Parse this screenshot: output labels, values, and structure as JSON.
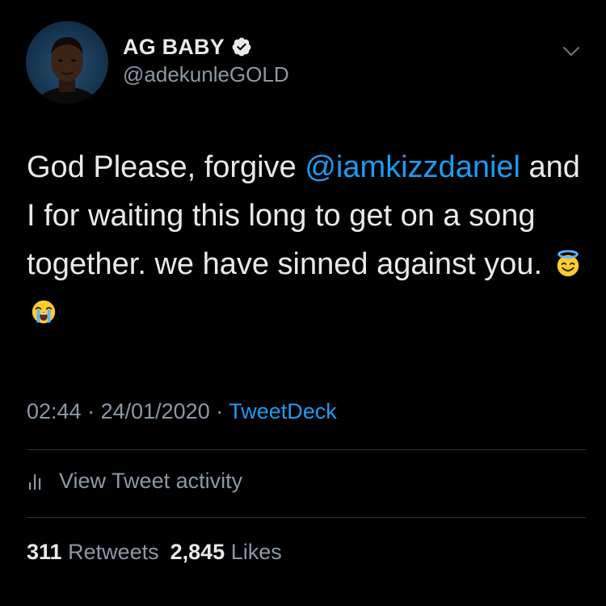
{
  "user": {
    "display_name": "AG BABY",
    "handle": "@adekunleGOLD",
    "verified": true
  },
  "tweet": {
    "text_before": "God Please, forgive ",
    "mention": "@iamkizzdaniel",
    "text_after": " and I for waiting this long to get on a song together. we have sinned against you.",
    "emojis": [
      "smiling-face-with-halo",
      "loudly-crying-face"
    ]
  },
  "meta": {
    "time": "02:44",
    "separator": " · ",
    "date": "24/01/2020",
    "source": "TweetDeck"
  },
  "activity": {
    "label": "View Tweet activity"
  },
  "stats": {
    "retweets_count": "311",
    "retweets_label": " Retweets",
    "likes_count": "2,845",
    "likes_label": " Likes"
  },
  "colors": {
    "background": "#000000",
    "text": "#e7e9ea",
    "secondary": "#8b98a5",
    "accent": "#1d9bf0",
    "divider": "#2f3336"
  }
}
